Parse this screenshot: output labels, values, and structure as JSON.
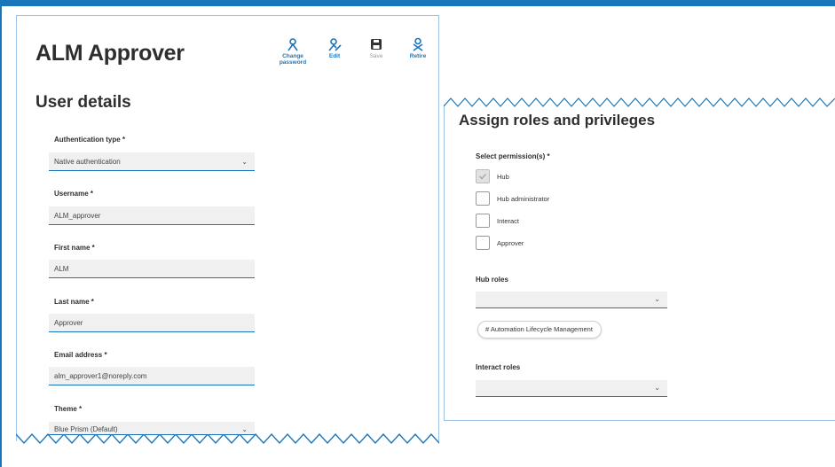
{
  "header": {
    "title": "ALM Approver",
    "section_title": "User details"
  },
  "toolbar": {
    "change_password": "Change password",
    "edit": "Edit",
    "save": "Save",
    "retire": "Retire"
  },
  "form": {
    "auth_type_label": "Authentication type *",
    "auth_type_value": "Native authentication",
    "username_label": "Username *",
    "username_value": "ALM_approver",
    "first_name_label": "First name *",
    "first_name_value": "ALM",
    "last_name_label": "Last name *",
    "last_name_value": "Approver",
    "email_label": "Email address *",
    "email_value": "alm_approver1@noreply.com",
    "theme_label": "Theme *",
    "theme_value": "Blue Prism (Default)"
  },
  "roles": {
    "title": "Assign roles and privileges",
    "permissions_label": "Select permission(s) *",
    "permissions": [
      {
        "label": "Hub",
        "checked": true
      },
      {
        "label": "Hub administrator",
        "checked": false
      },
      {
        "label": "Interact",
        "checked": false
      },
      {
        "label": "Approver",
        "checked": false
      }
    ],
    "hub_roles_label": "Hub roles",
    "hub_role_tag": "# Automation Lifecycle Management",
    "interact_roles_label": "Interact roles"
  },
  "colors": {
    "accent": "#1b75bb",
    "field_bg": "#f0f0f0",
    "text": "#2e2e2e"
  }
}
